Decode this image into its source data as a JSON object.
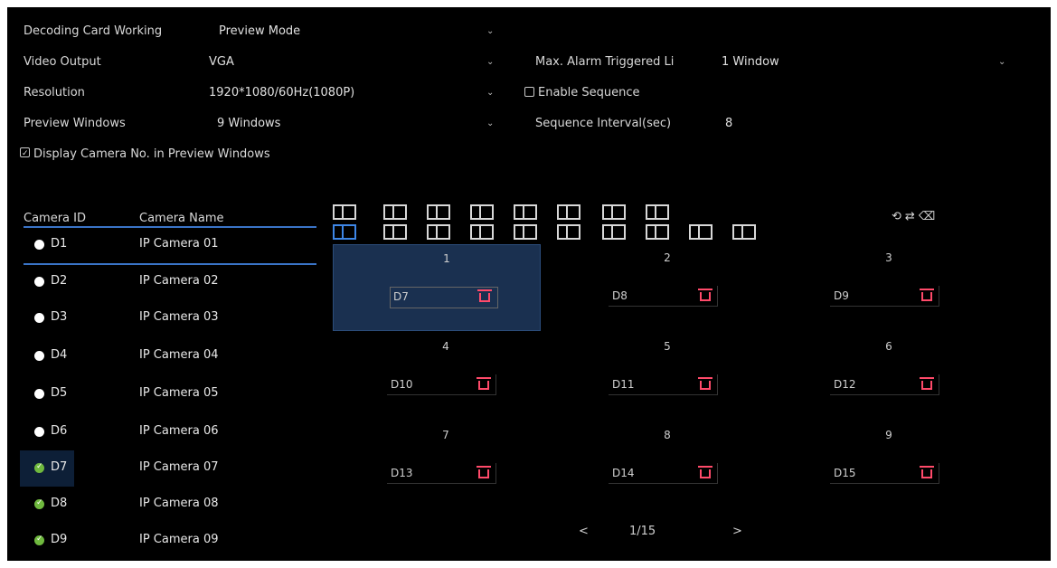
{
  "settings": {
    "decoding_card_label": "Decoding Card Working",
    "decoding_card_value": "Preview Mode",
    "video_output_label": "Video Output",
    "video_output_value": "VGA",
    "resolution_label": "Resolution",
    "resolution_value": "1920*1080/60Hz(1080P)",
    "preview_windows_label": "Preview Windows",
    "preview_windows_value": "9 Windows",
    "max_alarm_label": "Max. Alarm Triggered Li",
    "max_alarm_value": "1 Window",
    "enable_sequence_label": "Enable Sequence",
    "enable_sequence_checked": false,
    "sequence_interval_label": "Sequence Interval(sec)",
    "sequence_interval_value": "8",
    "display_camera_no_label": "Display Camera No. in Preview Windows",
    "display_camera_no_checked": true
  },
  "camera_list": {
    "col_id": "Camera ID",
    "col_name": "Camera Name",
    "rows": [
      {
        "id": "D1",
        "name": "IP Camera 01",
        "status": "white"
      },
      {
        "id": "D2",
        "name": "IP Camera 02",
        "status": "white"
      },
      {
        "id": "D3",
        "name": "IP Camera 03",
        "status": "white"
      },
      {
        "id": "D4",
        "name": "IP Camera 04",
        "status": "white"
      },
      {
        "id": "D5",
        "name": "IP Camera 05",
        "status": "white"
      },
      {
        "id": "D6",
        "name": "IP Camera 06",
        "status": "white"
      },
      {
        "id": "D7",
        "name": "IP Camera 07",
        "status": "ok"
      },
      {
        "id": "D8",
        "name": "IP Camera 08",
        "status": "ok"
      },
      {
        "id": "D9",
        "name": "IP Camera 09",
        "status": "ok"
      }
    ]
  },
  "grid": {
    "cells": [
      {
        "num": "1",
        "dev": "D7"
      },
      {
        "num": "2",
        "dev": "D8"
      },
      {
        "num": "3",
        "dev": "D9"
      },
      {
        "num": "4",
        "dev": "D10"
      },
      {
        "num": "5",
        "dev": "D11"
      },
      {
        "num": "6",
        "dev": "D12"
      },
      {
        "num": "7",
        "dev": "D13"
      },
      {
        "num": "8",
        "dev": "D14"
      },
      {
        "num": "9",
        "dev": "D15"
      }
    ]
  },
  "pager": {
    "prev": "<",
    "page": "1/15",
    "next": ">"
  },
  "colors": {
    "accent": "#3e86e6",
    "delete": "#ff4a6a",
    "ok": "#6fb93e"
  }
}
